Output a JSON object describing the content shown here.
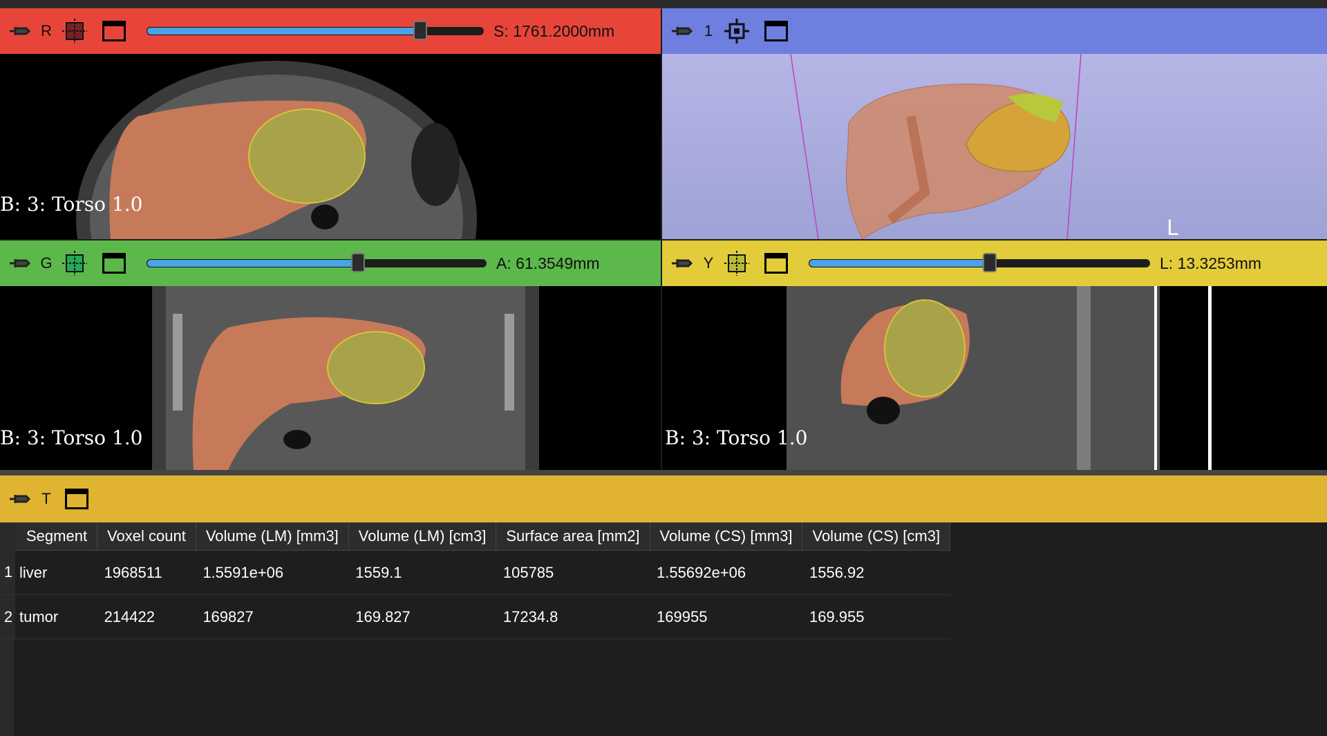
{
  "views": {
    "red": {
      "letter": "R",
      "readout": "S: 1761.2000mm",
      "slice_fraction": 0.81,
      "overlay": "B: 3: Torso 1.0",
      "color": "#e8453a"
    },
    "three_d": {
      "letter": "1",
      "color": "#6f7fe0",
      "orientation_label": "L"
    },
    "green": {
      "letter": "G",
      "readout": "A: 61.3549mm",
      "slice_fraction": 0.62,
      "overlay": "B: 3: Torso 1.0",
      "color": "#5cb84a"
    },
    "yellow": {
      "letter": "Y",
      "readout": "L: 13.3253mm",
      "slice_fraction": 0.53,
      "overlay": "B: 3: Torso 1.0",
      "color": "#e3cc3a"
    }
  },
  "table_view": {
    "letter": "T",
    "headers": [
      "Segment",
      "Voxel count",
      "Volume (LM) [mm3]",
      "Volume (LM) [cm3]",
      "Surface area [mm2]",
      "Volume (CS) [mm3]",
      "Volume (CS) [cm3]"
    ],
    "rows": [
      {
        "num": "1",
        "cells": [
          "liver",
          "1968511",
          "1.5591e+06",
          "1559.1",
          "105785",
          "1.55692e+06",
          "1556.92"
        ]
      },
      {
        "num": "2",
        "cells": [
          "tumor",
          "214422",
          "169827",
          "169.827",
          "17234.8",
          "169955",
          "169.955"
        ]
      }
    ]
  },
  "icons": {
    "pin": "pin-icon",
    "slice_intersect": "crosshair-grid-icon",
    "center_3d": "center-view-icon",
    "maximize": "window-icon"
  }
}
